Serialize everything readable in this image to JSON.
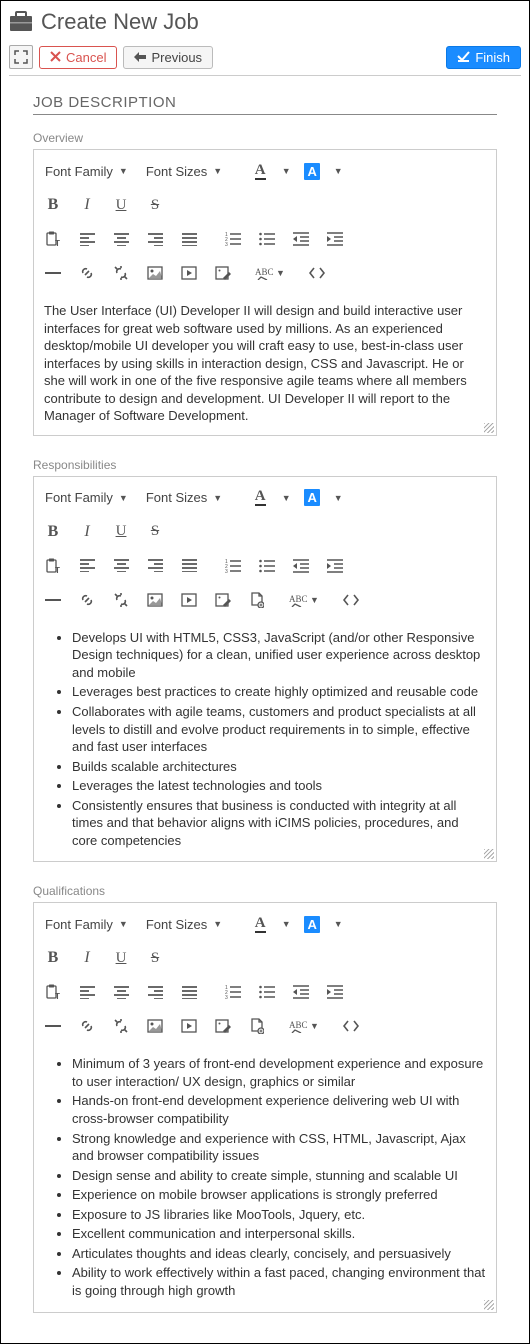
{
  "header": {
    "title": "Create New Job"
  },
  "actions": {
    "cancel": "Cancel",
    "previous": "Previous",
    "finish": "Finish"
  },
  "section": {
    "heading": "JOB DESCRIPTION"
  },
  "toolbar": {
    "fontFamily": "Font Family",
    "fontSizes": "Font Sizes"
  },
  "editors": {
    "overview": {
      "label": "Overview",
      "text": "The User Interface (UI) Developer II will design and build interactive user interfaces for great web software used by millions. As an experienced desktop/mobile UI developer you will craft easy to use, best-in-class user interfaces by using skills in interaction design, CSS and Javascript. He or she will work in one of the five responsive agile teams where all members contribute to design and development. UI Developer II will report to the Manager of Software Development."
    },
    "responsibilities": {
      "label": "Responsibilities",
      "items": [
        "Develops UI with HTML5, CSS3, JavaScript (and/or other Responsive Design techniques) for a clean, unified user experience across desktop and mobile",
        "Leverages best practices to create highly optimized and reusable code",
        "Collaborates with agile teams, customers and product specialists at all levels to distill and evolve product requirements in to simple, effective and fast user interfaces",
        "Builds scalable architectures",
        "Leverages the latest technologies and tools",
        "Consistently ensures that business is conducted with integrity at all times and that behavior aligns with iCIMS policies, procedures, and core competencies"
      ]
    },
    "qualifications": {
      "label": "Qualifications",
      "items": [
        "Minimum of 3 years of front-end development experience and exposure to user interaction/ UX design, graphics or similar",
        "Hands-on front-end development experience delivering web UI with cross-browser compatibility",
        "Strong knowledge and experience with CSS, HTML, Javascript, Ajax and browser compatibility issues",
        "Design sense and ability to create simple, stunning and scalable UI",
        "Experience on mobile browser applications is strongly preferred",
        "Exposure to JS libraries like MooTools, Jquery, etc.",
        "Excellent communication and interpersonal skills.",
        "Articulates thoughts and ideas clearly, concisely, and persuasively",
        "Ability to work effectively within a fast paced, changing environment that is going through high growth"
      ]
    }
  }
}
